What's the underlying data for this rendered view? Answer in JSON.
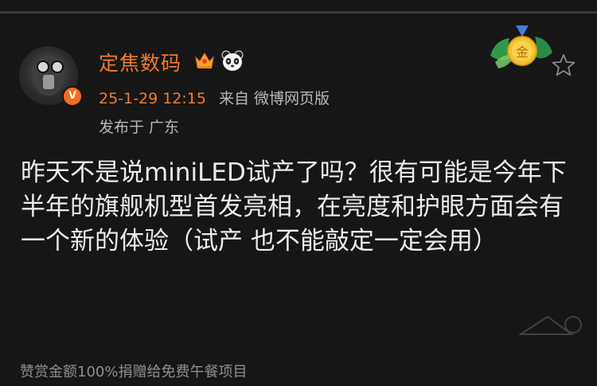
{
  "post": {
    "author": {
      "name": "定焦数码",
      "verified_icon": "verified-v-badge",
      "verified_label": "V",
      "badges": [
        "crown-icon",
        "panda-icon"
      ]
    },
    "timestamp": "25-1-29 12:15",
    "source": "来自 微博网页版",
    "location": "发布于 广东",
    "content": "昨天不是说miniLED试产了吗？很有可能是今年下半年的旗舰机型首发亮相，在亮度和护眼方面会有一个新的体验（试产 也不能敲定一定会用）",
    "medal": {
      "label": "金",
      "icon": "gold-medal-icon"
    },
    "favorite_icon": "star-outline-icon",
    "reward_note": "赞赏金额100%捐赠给免费午餐项目"
  },
  "colors": {
    "background": "#161616",
    "accent": "#f07c2a",
    "text": "#ececec",
    "muted": "#b8b8b8",
    "gold": "#f2c230"
  }
}
